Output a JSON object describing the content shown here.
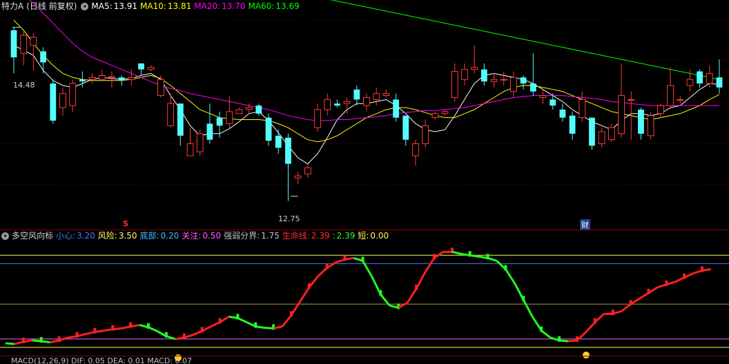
{
  "main_panel": {
    "stock_name": "特力A",
    "period": "(日线 前复权)",
    "ma": [
      {
        "label": "MA5:",
        "value": "13.91",
        "color": "#ffffff"
      },
      {
        "label": "MA10:",
        "value": "13.81",
        "color": "#ffff00"
      },
      {
        "label": "MA20:",
        "value": "13.70",
        "color": "#ff00ff"
      },
      {
        "label": "MA60:",
        "value": "13.69",
        "color": "#00ff00"
      }
    ],
    "high_label": "14.48",
    "low_label": "12.75",
    "event_markers": [
      {
        "text": "S",
        "color": "#ff3030"
      },
      {
        "text": "财",
        "color": "#ffffff"
      }
    ]
  },
  "indicator_panel": {
    "name": "多空风向标",
    "params": [
      {
        "label": "小心:",
        "value": "3.20",
        "label_color": "#3f7bff",
        "value_color": "#3f7bff"
      },
      {
        "label": "风险:",
        "value": "3.50",
        "label_color": "#ffff60",
        "value_color": "#ffff60"
      },
      {
        "label": "底部:",
        "value": "0.20",
        "label_color": "#40c0ff",
        "value_color": "#40c0ff"
      },
      {
        "label": "关注:",
        "value": "0.50",
        "label_color": "#ff60ff",
        "value_color": "#ff60ff"
      },
      {
        "label": "强弱分界:",
        "value": "1.75",
        "label_color": "#c0c0c0",
        "value_color": "#c0c0c0"
      },
      {
        "label": "生命线:",
        "value": "2.39",
        "label_color": "#ff3030",
        "value_color": "#ff3030"
      },
      {
        "label": ":",
        "value": "2.39",
        "label_color": "#30ff30",
        "value_color": "#30ff30"
      },
      {
        "label": "短:",
        "value": "0.00",
        "label_color": "#ffff60",
        "value_color": "#ffff60"
      }
    ]
  },
  "macd_panel": {
    "text": "MACD(12,26,9)  DIF: 0.05  DEA: 0.01  MACD: 0.07"
  },
  "colors": {
    "up": "#ff3b3b",
    "down": "#54fcfc",
    "grid": "#8b0000"
  },
  "chart_data": {
    "type": "candlestick",
    "ylim": [
      12.5,
      14.6
    ],
    "candles": [
      [
        14.45,
        14.18,
        14.48,
        14.02
      ],
      [
        14.22,
        14.4,
        14.44,
        14.1
      ],
      [
        14.3,
        14.38,
        14.42,
        14.05
      ],
      [
        14.24,
        14.13,
        14.28,
        14.02
      ],
      [
        13.92,
        13.55,
        13.96,
        13.52
      ],
      [
        13.68,
        13.82,
        13.88,
        13.6
      ],
      [
        13.7,
        13.92,
        13.96,
        13.64
      ],
      [
        13.96,
        13.94,
        14.04,
        13.88
      ],
      [
        13.96,
        13.98,
        14.02,
        13.92
      ],
      [
        13.96,
        14.0,
        14.06,
        13.94
      ],
      [
        13.98,
        13.99,
        14.04,
        13.88
      ],
      [
        13.98,
        13.95,
        14.0,
        13.9
      ],
      [
        13.96,
        13.98,
        14.06,
        13.9
      ],
      [
        14.12,
        14.06,
        14.12,
        14.0
      ],
      [
        14.06,
        14.08,
        14.1,
        14.04
      ],
      [
        13.8,
        13.96,
        14.0,
        13.78
      ],
      [
        13.5,
        13.72,
        13.82,
        13.48
      ],
      [
        13.72,
        13.4,
        13.72,
        13.3
      ],
      [
        13.2,
        13.32,
        13.48,
        13.2
      ],
      [
        13.24,
        13.42,
        13.46,
        13.2
      ],
      [
        13.52,
        13.36,
        13.72,
        13.32
      ],
      [
        13.58,
        13.5,
        13.64,
        13.38
      ],
      [
        13.52,
        13.64,
        13.8,
        13.46
      ],
      [
        13.62,
        13.66,
        13.68,
        13.62
      ],
      [
        13.66,
        13.68,
        13.72,
        13.62
      ],
      [
        13.7,
        13.62,
        13.72,
        13.6
      ],
      [
        13.58,
        13.35,
        13.62,
        13.3
      ],
      [
        13.4,
        13.28,
        13.46,
        13.22
      ],
      [
        13.38,
        13.12,
        13.42,
        12.75
      ],
      [
        12.98,
        13.0,
        13.04,
        12.92
      ],
      [
        13.02,
        13.08,
        13.12,
        12.98
      ],
      [
        13.48,
        13.66,
        13.72,
        13.44
      ],
      [
        13.66,
        13.76,
        13.82,
        13.6
      ],
      [
        13.72,
        13.7,
        13.76,
        13.68
      ],
      [
        13.72,
        13.74,
        13.78,
        13.62
      ],
      [
        13.86,
        13.76,
        13.9,
        13.7
      ],
      [
        13.7,
        13.78,
        13.82,
        13.64
      ],
      [
        13.76,
        13.82,
        13.88,
        13.7
      ],
      [
        13.8,
        13.82,
        13.86,
        13.78
      ],
      [
        13.76,
        13.58,
        13.82,
        13.54
      ],
      [
        13.6,
        13.36,
        13.6,
        13.3
      ],
      [
        13.2,
        13.32,
        13.36,
        13.1
      ],
      [
        13.32,
        13.5,
        13.56,
        13.28
      ],
      [
        13.58,
        13.62,
        13.64,
        13.56
      ],
      [
        13.62,
        13.64,
        13.66,
        13.6
      ],
      [
        13.78,
        14.04,
        14.12,
        13.74
      ],
      [
        13.96,
        14.06,
        14.12,
        13.9
      ],
      [
        14.06,
        14.08,
        14.3,
        14.02
      ],
      [
        14.06,
        13.94,
        14.12,
        13.9
      ],
      [
        13.94,
        13.96,
        14.02,
        13.88
      ],
      [
        13.96,
        13.96,
        14.04,
        13.9
      ],
      [
        13.84,
        13.98,
        14.04,
        13.78
      ],
      [
        13.98,
        13.92,
        14.0,
        13.86
      ],
      [
        13.92,
        13.84,
        14.22,
        13.8
      ],
      [
        13.78,
        13.8,
        13.86,
        13.72
      ],
      [
        13.76,
        13.7,
        13.82,
        13.66
      ],
      [
        13.66,
        13.58,
        13.72,
        13.54
      ],
      [
        13.6,
        13.42,
        13.64,
        13.36
      ],
      [
        13.58,
        13.76,
        13.84,
        13.54
      ],
      [
        13.58,
        13.3,
        13.58,
        13.26
      ],
      [
        13.32,
        13.44,
        13.48,
        13.28
      ],
      [
        13.36,
        13.48,
        13.52,
        13.34
      ],
      [
        13.42,
        13.8,
        14.12,
        13.38
      ],
      [
        13.76,
        13.76,
        13.84,
        13.36
      ],
      [
        13.66,
        13.42,
        13.68,
        13.36
      ],
      [
        13.4,
        13.6,
        13.64,
        13.36
      ],
      [
        13.62,
        13.7,
        13.72,
        13.58
      ],
      [
        13.7,
        13.9,
        14.08,
        13.66
      ],
      [
        13.76,
        13.76,
        13.8,
        13.72
      ],
      [
        13.9,
        13.96,
        14.06,
        13.84
      ],
      [
        14.04,
        13.92,
        14.06,
        13.88
      ],
      [
        13.92,
        14.02,
        14.1,
        13.88
      ],
      [
        13.98,
        13.88,
        14.16,
        13.82
      ]
    ],
    "series": [
      {
        "values": [
          14.3,
          14.25,
          14.2,
          14.05,
          13.95,
          13.9,
          13.88,
          13.92,
          13.96,
          13.98,
          13.97,
          13.96,
          13.97,
          14.0,
          14.02,
          13.96,
          13.8,
          13.66,
          13.5,
          13.4,
          13.42,
          13.42,
          13.47,
          13.54,
          13.62,
          13.64,
          13.55,
          13.43,
          13.3,
          13.18,
          13.12,
          13.22,
          13.38,
          13.56,
          13.66,
          13.72,
          13.72,
          13.74,
          13.76,
          13.7,
          13.62,
          13.52,
          13.46,
          13.44,
          13.46,
          13.6,
          13.76,
          13.92,
          14.0,
          14.02,
          14.0,
          13.98,
          13.96,
          13.92,
          13.86,
          13.8,
          13.74,
          13.66,
          13.6,
          13.54,
          13.5,
          13.46,
          13.55,
          13.62,
          13.62,
          13.6,
          13.62,
          13.68,
          13.7,
          13.78,
          13.86,
          13.92,
          13.91
        ]
      },
      {
        "values": [
          14.55,
          14.45,
          14.32,
          14.2,
          14.1,
          14.02,
          13.98,
          13.96,
          13.95,
          13.95,
          13.95,
          13.95,
          13.96,
          13.98,
          14.0,
          13.97,
          13.9,
          13.82,
          13.74,
          13.66,
          13.62,
          13.58,
          13.57,
          13.56,
          13.56,
          13.56,
          13.55,
          13.52,
          13.48,
          13.42,
          13.36,
          13.34,
          13.36,
          13.4,
          13.46,
          13.52,
          13.58,
          13.62,
          13.66,
          13.68,
          13.68,
          13.66,
          13.63,
          13.6,
          13.58,
          13.58,
          13.62,
          13.66,
          13.72,
          13.78,
          13.84,
          13.88,
          13.9,
          13.9,
          13.88,
          13.86,
          13.84,
          13.8,
          13.76,
          13.72,
          13.68,
          13.64,
          13.62,
          13.6,
          13.58,
          13.56,
          13.58,
          13.6,
          13.62,
          13.66,
          13.7,
          13.76,
          13.81
        ]
      },
      {
        "values": [
          14.88,
          14.8,
          14.72,
          14.62,
          14.52,
          14.42,
          14.32,
          14.24,
          14.18,
          14.14,
          14.1,
          14.06,
          14.02,
          13.98,
          13.94,
          13.9,
          13.87,
          13.85,
          13.82,
          13.8,
          13.78,
          13.76,
          13.74,
          13.72,
          13.7,
          13.68,
          13.66,
          13.63,
          13.6,
          13.58,
          13.56,
          13.55,
          13.55,
          13.56,
          13.56,
          13.57,
          13.58,
          13.59,
          13.6,
          13.62,
          13.63,
          13.64,
          13.65,
          13.65,
          13.66,
          13.67,
          13.68,
          13.7,
          13.72,
          13.74,
          13.76,
          13.78,
          13.79,
          13.8,
          13.8,
          13.8,
          13.8,
          13.79,
          13.78,
          13.77,
          13.76,
          13.74,
          13.73,
          13.72,
          13.71,
          13.7,
          13.7,
          13.7,
          13.7,
          13.7,
          13.7,
          13.7,
          13.7
        ]
      },
      {
        "values": [
          15.4,
          15.38,
          15.36,
          15.34,
          15.32,
          15.3,
          15.28,
          15.26,
          15.24,
          15.22,
          15.2,
          15.18,
          15.16,
          15.14,
          15.12,
          15.1,
          15.08,
          15.06,
          15.04,
          15.02,
          15.0,
          14.98,
          14.96,
          14.94,
          14.92,
          14.9,
          14.88,
          14.86,
          14.84,
          14.82,
          14.8,
          14.78,
          14.76,
          14.74,
          14.72,
          14.7,
          14.68,
          14.66,
          14.64,
          14.62,
          14.6,
          14.58,
          14.56,
          14.54,
          14.52,
          14.5,
          14.48,
          14.46,
          14.44,
          14.42,
          14.4,
          14.38,
          14.36,
          14.34,
          14.32,
          14.3,
          14.28,
          14.26,
          14.24,
          14.22,
          14.2,
          14.18,
          14.16,
          14.14,
          14.12,
          14.1,
          14.08,
          14.06,
          14.04,
          14.02,
          14.0,
          13.98,
          13.96
        ]
      }
    ],
    "indicator": {
      "ylim": [
        0,
        4
      ],
      "levels": [
        3.5,
        3.2,
        1.75,
        0.5,
        0.2
      ],
      "values": [
        0.35,
        0.32,
        0.4,
        0.45,
        0.42,
        0.38,
        0.45,
        0.55,
        0.6,
        0.68,
        0.75,
        0.8,
        0.85,
        0.88,
        0.95,
        1.0,
        0.92,
        0.78,
        0.6,
        0.5,
        0.55,
        0.65,
        0.78,
        0.95,
        1.1,
        1.3,
        1.25,
        1.1,
        0.95,
        0.9,
        0.88,
        0.95,
        1.35,
        1.85,
        2.35,
        2.75,
        3.05,
        3.25,
        3.35,
        3.4,
        3.3,
        2.75,
        2.1,
        1.7,
        1.62,
        1.8,
        2.3,
        2.9,
        3.4,
        3.62,
        3.62,
        3.55,
        3.5,
        3.45,
        3.4,
        3.3,
        3.0,
        2.5,
        1.9,
        1.3,
        0.8,
        0.55,
        0.45,
        0.42,
        0.45,
        0.75,
        1.1,
        1.4,
        1.4,
        1.5,
        1.75,
        1.95,
        2.15,
        2.35,
        2.45,
        2.55,
        2.7,
        2.85,
        2.95,
        3.0
      ]
    }
  }
}
